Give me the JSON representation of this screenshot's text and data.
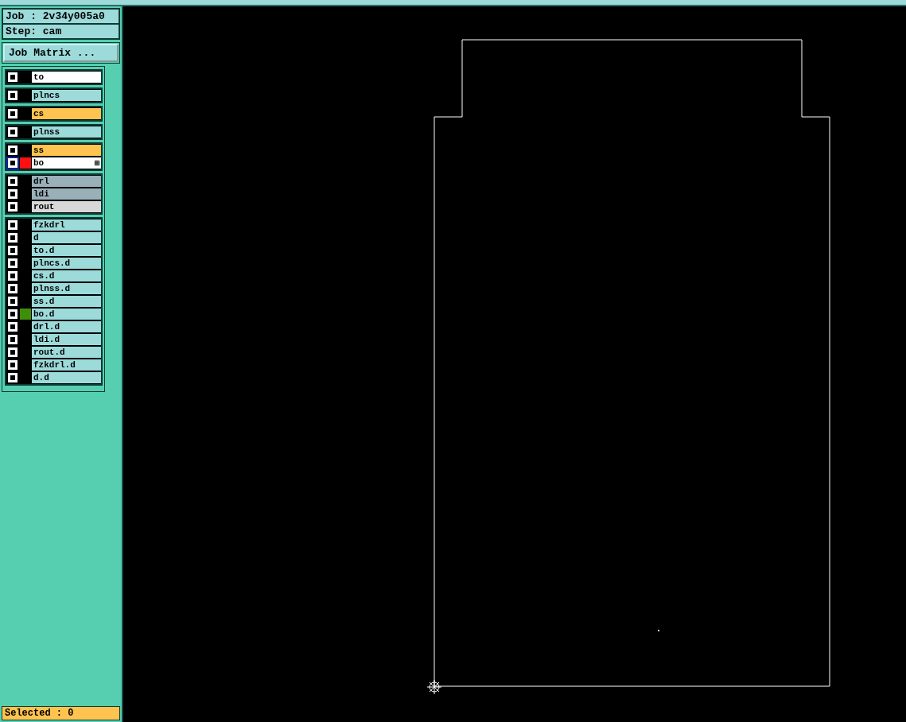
{
  "job": {
    "label": "Job : 2v34y005a0"
  },
  "step": {
    "label": "Step: cam"
  },
  "matrix_button": {
    "label": "Job Matrix ..."
  },
  "layer_groups": [
    [
      {
        "name": "to",
        "color": "#ffffff",
        "selected": false,
        "work_layer": false
      }
    ],
    [
      {
        "name": "plncs",
        "color": "#9ddada",
        "selected": false,
        "work_layer": false
      }
    ],
    [
      {
        "name": "cs",
        "color": "#ffc34f",
        "selected": false,
        "work_layer": false
      }
    ],
    [
      {
        "name": "plnss",
        "color": "#9ddada",
        "selected": false,
        "work_layer": false
      }
    ],
    [
      {
        "name": "ss",
        "color": "#ffc34f",
        "selected": false,
        "work_layer": false
      },
      {
        "name": "bo",
        "color": "#ffffff",
        "selected": true,
        "work_layer": true,
        "swatch": {
          "color": "#ff1010"
        }
      }
    ],
    [
      {
        "name": "drl",
        "color": "#9ab0b8",
        "selected": false,
        "work_layer": false
      },
      {
        "name": "ldi",
        "color": "#9ab0b8",
        "selected": false,
        "work_layer": false
      },
      {
        "name": "rout",
        "color": "#d8d8d8",
        "selected": false,
        "work_layer": false
      }
    ],
    [
      {
        "name": "fzkdrl",
        "color": "#9ddada",
        "selected": false,
        "work_layer": false
      },
      {
        "name": "d",
        "color": "#9ddada",
        "selected": false,
        "work_layer": false
      },
      {
        "name": "to.d",
        "color": "#9ddada",
        "selected": false,
        "work_layer": false
      },
      {
        "name": "plncs.d",
        "color": "#9ddada",
        "selected": false,
        "work_layer": false
      },
      {
        "name": "cs.d",
        "color": "#9ddada",
        "selected": false,
        "work_layer": false
      },
      {
        "name": "plnss.d",
        "color": "#9ddada",
        "selected": false,
        "work_layer": false
      },
      {
        "name": "ss.d",
        "color": "#9ddada",
        "selected": false,
        "work_layer": false
      },
      {
        "name": "bo.d",
        "color": "#9ddada",
        "selected": false,
        "work_layer": false,
        "swatch": {
          "color": "#3e8e0a"
        }
      },
      {
        "name": "drl.d",
        "color": "#9ddada",
        "selected": false,
        "work_layer": false
      },
      {
        "name": "ldi.d",
        "color": "#9ddada",
        "selected": false,
        "work_layer": false
      },
      {
        "name": "rout.d",
        "color": "#9ddada",
        "selected": false,
        "work_layer": false
      },
      {
        "name": "fzkdrl.d",
        "color": "#9ddada",
        "selected": false,
        "work_layer": false
      },
      {
        "name": "d.d",
        "color": "#9ddada",
        "selected": false,
        "work_layer": false
      }
    ]
  ],
  "status": {
    "label": "Selected : 0"
  }
}
